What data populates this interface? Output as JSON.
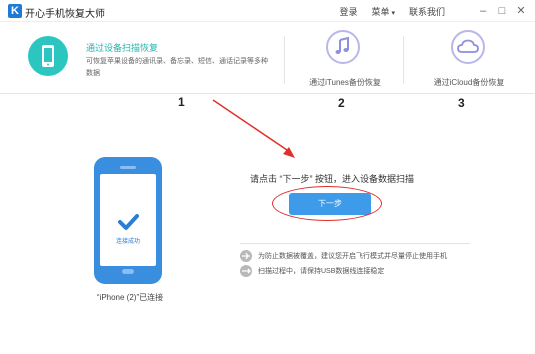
{
  "app": {
    "logo_letter": "K",
    "title": "开心手机恢复大师",
    "menu": {
      "login": "登录",
      "menu_label": "菜单",
      "contact": "联系我们"
    },
    "window_controls": {
      "minimize": "–",
      "maximize": "□",
      "close": "✕"
    }
  },
  "modes": [
    {
      "title": "通过设备扫描恢复",
      "description": "可恢复苹果设备的通讯录、备忘录、短信、通话记录等多种数据",
      "icon": "phone-icon",
      "active": true
    },
    {
      "title": "通过iTunes备份恢复",
      "icon": "music-note-icon",
      "number": "2"
    },
    {
      "title": "通过iCloud备份恢复",
      "icon": "cloud-icon",
      "number": "3"
    }
  ],
  "annotation": {
    "number_1": "1"
  },
  "device": {
    "status_text": "连接成功",
    "caption": "“iPhone (2)”已连接"
  },
  "main": {
    "instruction": "请点击 “下一步” 按钮，进入设备数据扫描",
    "next_button": "下一步"
  },
  "notes": [
    {
      "icon": "airplane-icon",
      "text": "为防止数据被覆盖，建议您开启飞行模式并尽量停止使用手机"
    },
    {
      "icon": "usb-icon",
      "text": "扫描过程中，请保持USB数据线连接稳定"
    }
  ],
  "colors": {
    "accent_teal": "#2bc6c0",
    "brand_blue": "#3d9be9",
    "annotation_red": "#e0302b",
    "icon_lavender": "#b7b7ea"
  }
}
